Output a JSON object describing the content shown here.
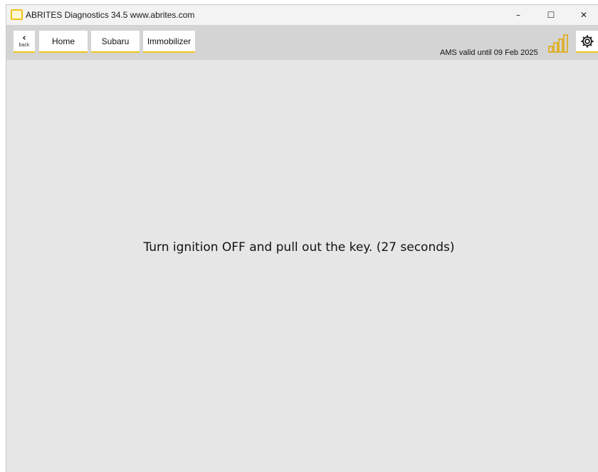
{
  "window": {
    "title": "ABRITES Diagnostics 34.5  www.abrites.com",
    "minimize_glyph": "–",
    "maximize_glyph": "☐",
    "close_glyph": "✕"
  },
  "toolbar": {
    "back_icon": "chevron-left-icon",
    "back_label": "back",
    "breadcrumbs": [
      "Home",
      "Subaru",
      "Immobilizer"
    ],
    "ams_status": "AMS valid until 09 Feb 2025",
    "signal_icon": "signal-strength-icon",
    "settings_icon": "gear-icon",
    "accent_color": "#f0c419"
  },
  "main": {
    "message": "Turn ignition OFF and pull out the key. (27 seconds)"
  }
}
